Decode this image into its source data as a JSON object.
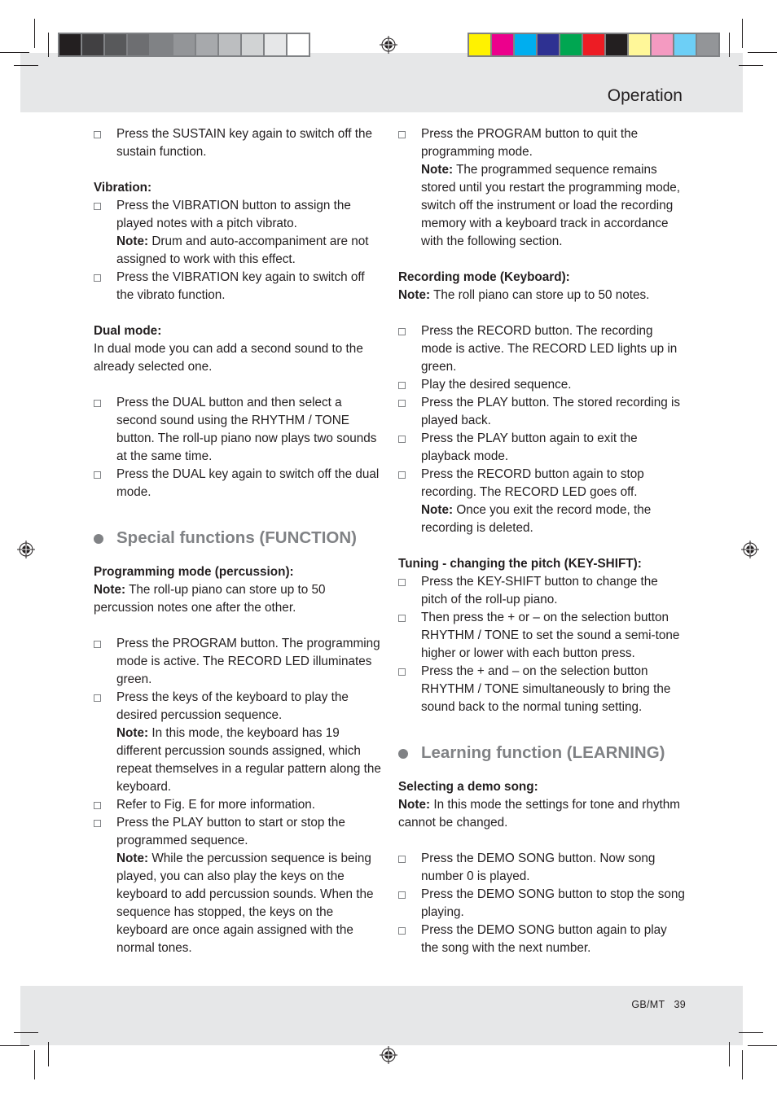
{
  "header": {
    "title": "Operation"
  },
  "footer": {
    "page_label": "GB/MT   39"
  },
  "print_marks": {
    "grayscale_swatches": [
      "#231f20",
      "#414042",
      "#58595b",
      "#6d6e71",
      "#808285",
      "#939598",
      "#a7a9ac",
      "#bcbec0",
      "#d1d3d4",
      "#e6e7e8",
      "#ffffff"
    ],
    "color_swatches": [
      "#fff200",
      "#ec008c",
      "#00aeef",
      "#2e3192",
      "#00a651",
      "#ed1c24",
      "#231f20",
      "#fff799",
      "#f49ac1",
      "#6dcff6",
      "#939598"
    ],
    "accent_gray": "#808285"
  },
  "left_column": {
    "sustain_item": "Press the SUSTAIN key again to switch off the sustain function.",
    "vibration": {
      "heading": "Vibration:",
      "item1": "Press the VIBRATION button to assign the played notes with a pitch vibrato.",
      "item1_note_label": "Note:",
      "item1_note": " Drum and auto-accompaniment are not assigned to work with this effect.",
      "item2": "Press the VIBRATION key again to switch off the vibrato function."
    },
    "dual": {
      "heading": "Dual mode:",
      "intro": "In dual mode you can add a second sound to the already selected one.",
      "item1": "Press the DUAL button and then select a second sound using the RHYTHM / TONE button. The roll-up piano now plays two sounds at the same time.",
      "item2": "Press the DUAL key again to switch off the dual mode."
    },
    "special": {
      "section_title": "Special functions (FUNCTION)",
      "heading": "Programming mode (percussion):",
      "note_label": "Note:",
      "note": " The roll-up piano can store up to 50 percussion notes one after the other.",
      "item1": "Press the PROGRAM button. The programming mode is active. The RECORD LED illuminates green.",
      "item2": "Press the keys of the keyboard to play the desired percussion sequence.",
      "item2_note_label": "Note:",
      "item2_note": " In this mode, the keyboard has 19 different percussion sounds assigned, which repeat themselves in a regular pattern along the keyboard.",
      "item3": "Refer to Fig. E for more information.",
      "item4": "Press the PLAY button to start or stop the programmed sequence.",
      "item4_note_label": "Note:",
      "item4_note": " While the percussion sequence is being played, you can also play the keys on the keyboard to add percussion sounds. When the sequence has stopped, the keys on the keyboard are once again assigned with the normal tones."
    }
  },
  "right_column": {
    "program_quit": {
      "item": "Press the PROGRAM button to quit the programming mode.",
      "note_label": "Note:",
      "note": " The programmed sequence remains stored until you restart the programming mode, switch off the instrument or load the recording memory with a keyboard track in accordance with the following section."
    },
    "recording": {
      "heading": "Recording mode (Keyboard):",
      "note_label": "Note:",
      "note": " The roll piano can store up to 50 notes.",
      "item1": "Press the RECORD button. The recording mode is active. The RECORD LED lights up in green.",
      "item2": "Play the desired sequence.",
      "item3": "Press the PLAY button. The stored recording is played back.",
      "item4": "Press the PLAY button again to exit the playback mode.",
      "item5": "Press the RECORD button again to stop recording. The RECORD LED goes off.",
      "item5_note_label": "Note:",
      "item5_note": " Once you exit the record mode, the recording is deleted."
    },
    "tuning": {
      "heading": "Tuning - changing the pitch (KEY-SHIFT):",
      "item1": "Press the KEY-SHIFT button to change the pitch of the roll-up piano.",
      "item2": "Then press the + or – on the selection button RHYTHM / TONE to set the sound a semi-tone higher or lower with each button press.",
      "item3": "Press the + and – on the selection button RHYTHM / TONE simultaneously to bring the sound back to the normal tuning setting."
    },
    "learning": {
      "section_title": "Learning function (LEARNING)",
      "heading": "Selecting a demo song:",
      "note_label": "Note:",
      "note": " In this mode the settings for tone and rhythm cannot be changed.",
      "item1": "Press the DEMO SONG button. Now song number 0 is played.",
      "item2": "Press the DEMO SONG button to stop the song playing.",
      "item3": "Press the DEMO SONG button again to play the song with the next number."
    }
  }
}
